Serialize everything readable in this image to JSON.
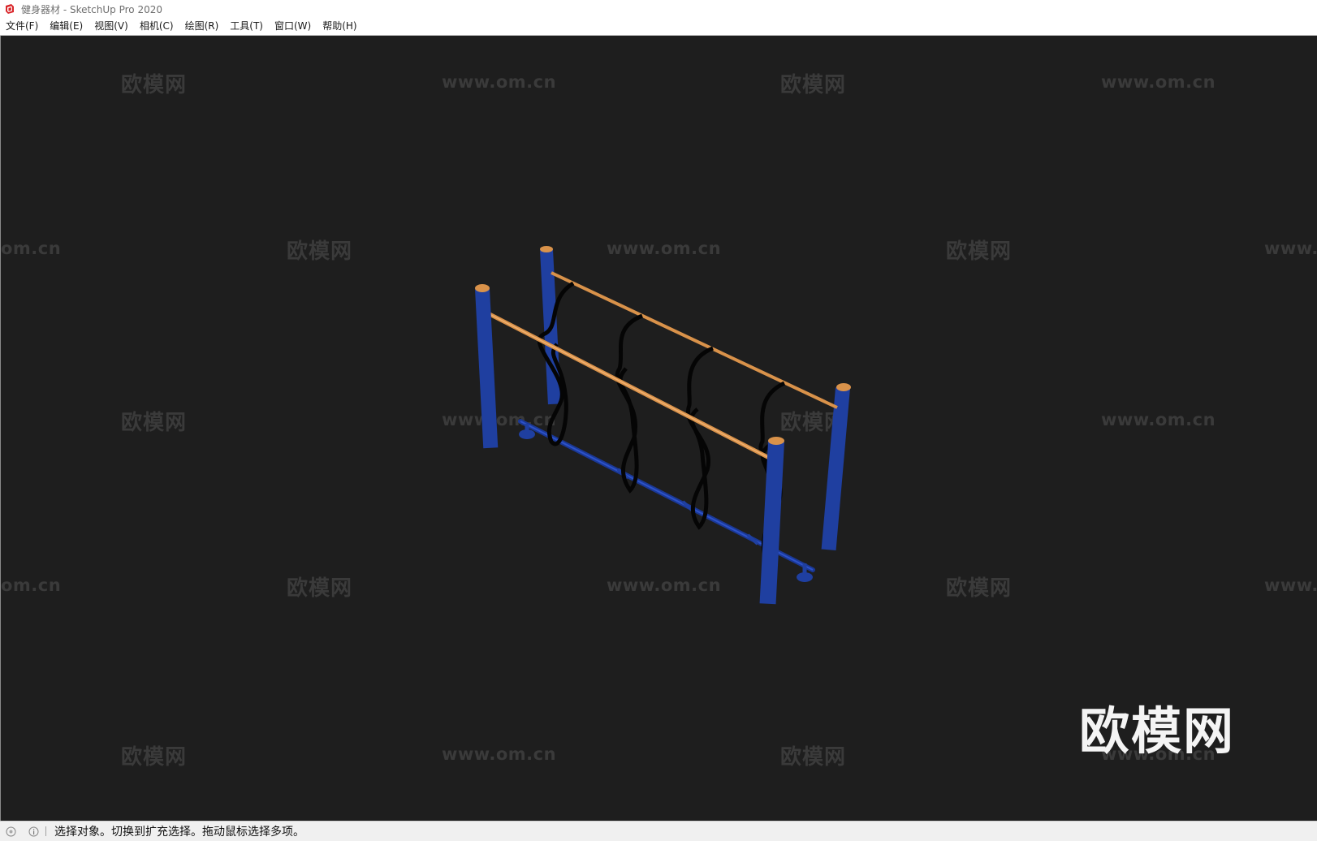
{
  "window": {
    "title": "健身器材 - SketchUp Pro 2020"
  },
  "menu": {
    "items": [
      "文件(F)",
      "编辑(E)",
      "视图(V)",
      "相机(C)",
      "绘图(R)",
      "工具(T)",
      "窗口(W)",
      "帮助(H)"
    ]
  },
  "watermark": {
    "logo_text": "欧模网",
    "url_text": "www.om.cn",
    "partial_url_left": "om.cn",
    "partial_url_right": "www."
  },
  "status": {
    "message": "选择对象。切换到扩充选择。拖动鼠标选择多项。"
  },
  "colors": {
    "viewport_bg": "#1e1e1e",
    "post_blue": "#1f3fa0",
    "bar_orange": "#d9924a",
    "rope_black": "#050505"
  },
  "icons": {
    "app": "sketchup-logo-icon",
    "status_1": "geolocation-icon",
    "status_2": "info-icon"
  }
}
